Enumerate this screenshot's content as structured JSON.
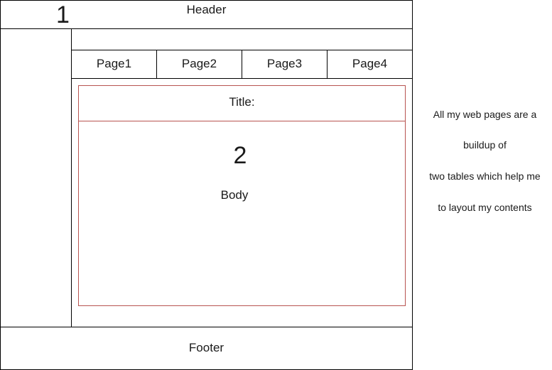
{
  "layout_diagram": {
    "header": {
      "label": "Header",
      "marker": "1"
    },
    "nav": {
      "tabs": [
        {
          "label": "Page1"
        },
        {
          "label": "Page2"
        },
        {
          "label": "Page3"
        },
        {
          "label": "Page4"
        }
      ]
    },
    "content": {
      "title_label": "Title:",
      "marker": "2",
      "body_label": "Body"
    },
    "footer": {
      "label": "Footer"
    },
    "border_colors": {
      "outer_table": "#000000",
      "inner_table": "#b85450"
    }
  },
  "side_note": {
    "lines": [
      "All my web pages are a",
      "buildup of",
      "two tables which help me",
      "to layout my contents"
    ]
  }
}
